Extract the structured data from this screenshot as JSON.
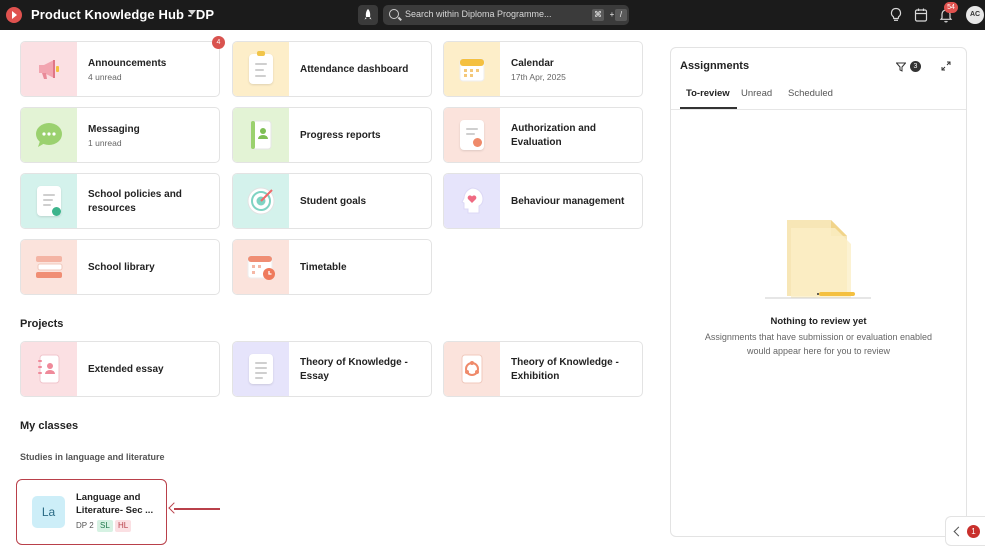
{
  "topbar": {
    "app_title": "Product Knowledge Hub - DP",
    "search_placeholder": "Search within Diploma Programme...",
    "shortcut_key1": "⌘",
    "shortcut_plus": "+",
    "shortcut_key2": "/",
    "notification_count": "54",
    "avatar_initials": "AC"
  },
  "tiles": [
    {
      "label": "Announcements",
      "sub": "4 unread",
      "badge": "4",
      "icon": "megaphone-icon"
    },
    {
      "label": "Attendance dashboard",
      "icon": "clipboard-icon"
    },
    {
      "label": "Calendar",
      "sub": "17th Apr, 2025",
      "icon": "calendar-icon"
    },
    {
      "label": "Messaging",
      "sub": "1 unread",
      "icon": "chat-bubble-icon"
    },
    {
      "label": "Progress reports",
      "icon": "report-book-icon"
    },
    {
      "label": "Authorization and Evaluation",
      "icon": "certificate-icon"
    },
    {
      "label": "School policies and resources",
      "icon": "policy-document-icon"
    },
    {
      "label": "Student goals",
      "icon": "target-icon"
    },
    {
      "label": "Behaviour management",
      "icon": "heart-head-icon"
    },
    {
      "label": "School library",
      "icon": "books-icon"
    },
    {
      "label": "Timetable",
      "icon": "timetable-icon"
    }
  ],
  "projects": {
    "title": "Projects",
    "items": [
      {
        "label": "Extended essay",
        "icon": "notebook-icon"
      },
      {
        "label": "Theory of Knowledge - Essay",
        "icon": "essay-icon"
      },
      {
        "label": "Theory of Knowledge - Exhibition",
        "icon": "exhibition-icon"
      }
    ]
  },
  "my_classes": {
    "title": "My classes",
    "group": "Studies in language and literature",
    "class": {
      "short": "La",
      "name": "Language and Literature- Sec ...",
      "grade": "DP 2",
      "tag_sl": "SL",
      "tag_hl": "HL"
    }
  },
  "assignments": {
    "title": "Assignments",
    "filter_count": "3",
    "tabs": [
      "To-review",
      "Unread",
      "Scheduled"
    ],
    "empty_title": "Nothing to review yet",
    "empty_desc": "Assignments that have submission or evaluation enabled would appear here for you to review"
  },
  "side_tab": {
    "badge": "1"
  },
  "colors": {
    "accent_red": "#d9534f",
    "pink": "#fbe0e3",
    "yellow": "#fdeec9",
    "green": "#e3f3d5",
    "teal": "#d4f2ec",
    "lavender": "#e6e4fb",
    "peach": "#fbe3dc"
  }
}
